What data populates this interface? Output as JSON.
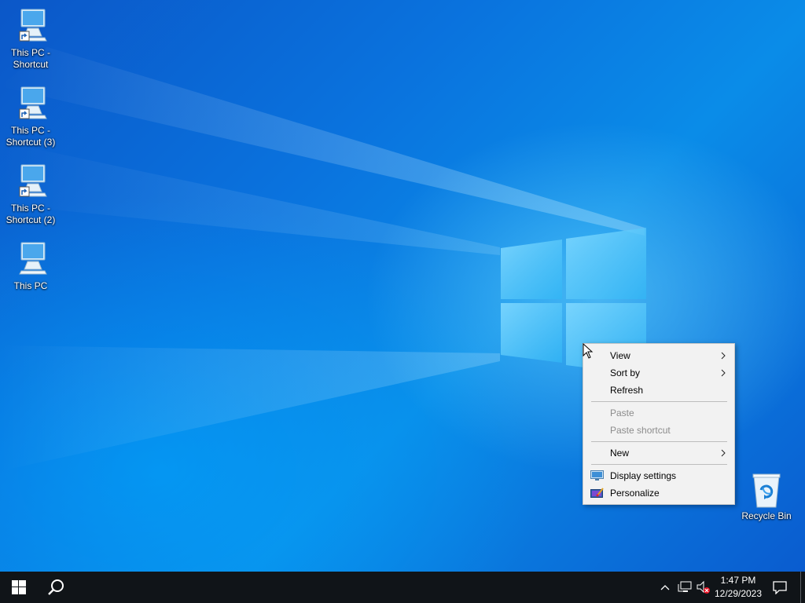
{
  "desktop": {
    "icons": [
      {
        "label_line1": "This PC -",
        "label_line2": "Shortcut",
        "icon": "computer-shortcut-icon"
      },
      {
        "label_line1": "This PC -",
        "label_line2": "Shortcut (3)",
        "icon": "computer-shortcut-icon"
      },
      {
        "label_line1": "This PC -",
        "label_line2": "Shortcut (2)",
        "icon": "computer-shortcut-icon"
      },
      {
        "label_line1": "This PC",
        "label_line2": "",
        "icon": "computer-icon"
      }
    ],
    "recycle_bin": {
      "label": "Recycle Bin",
      "icon": "recycle-bin-icon"
    }
  },
  "context_menu": {
    "items": [
      {
        "label": "View",
        "has_submenu": true,
        "enabled": true
      },
      {
        "label": "Sort by",
        "has_submenu": true,
        "enabled": true
      },
      {
        "label": "Refresh",
        "has_submenu": false,
        "enabled": true
      },
      {
        "label": "Paste",
        "has_submenu": false,
        "enabled": false
      },
      {
        "label": "Paste shortcut",
        "has_submenu": false,
        "enabled": false
      },
      {
        "label": "New",
        "has_submenu": true,
        "enabled": true
      },
      {
        "label": "Display settings",
        "has_submenu": false,
        "enabled": true,
        "icon": "display-settings-icon"
      },
      {
        "label": "Personalize",
        "has_submenu": false,
        "enabled": true,
        "icon": "personalize-icon"
      }
    ]
  },
  "taskbar": {
    "start_icon": "windows-logo-icon",
    "search_icon": "search-icon",
    "tray": {
      "chevron_icon": "chevron-up-icon",
      "network_icon": "network-icon",
      "volume_icon": "volume-muted-icon",
      "time": "1:47 PM",
      "date": "12/29/2023",
      "notification_icon": "action-center-icon"
    }
  },
  "colors": {
    "desktop_blue": "#0a73de",
    "taskbar_bg": "#101418",
    "menu_bg": "#f2f2f2",
    "disabled_text": "#8c8c8c"
  }
}
